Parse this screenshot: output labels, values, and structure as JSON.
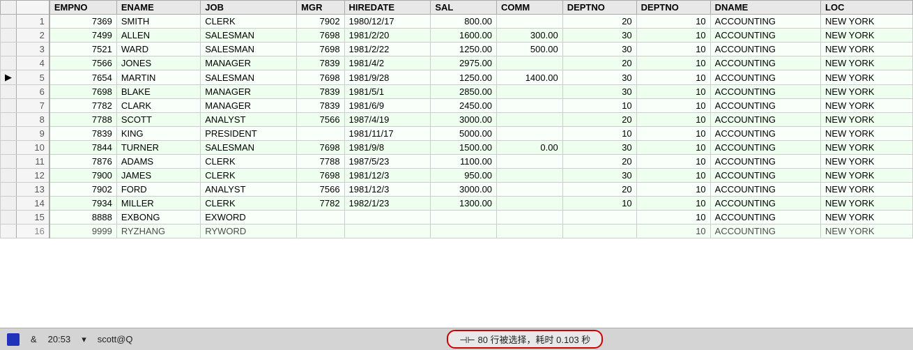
{
  "columns": [
    {
      "key": "indicator",
      "label": ""
    },
    {
      "key": "rownum",
      "label": ""
    },
    {
      "key": "empno",
      "label": "EMPNO"
    },
    {
      "key": "ename",
      "label": "ENAME"
    },
    {
      "key": "job",
      "label": "JOB"
    },
    {
      "key": "mgr",
      "label": "MGR"
    },
    {
      "key": "hiredate",
      "label": "HIREDATE"
    },
    {
      "key": "sal",
      "label": "SAL"
    },
    {
      "key": "comm",
      "label": "COMM"
    },
    {
      "key": "deptno1",
      "label": "DEPTNO"
    },
    {
      "key": "deptno2",
      "label": "DEPTNO"
    },
    {
      "key": "dname",
      "label": "DNAME"
    },
    {
      "key": "loc",
      "label": "LOC"
    }
  ],
  "rows": [
    {
      "rownum": 1,
      "empno": "7369",
      "ename": "SMITH",
      "job": "CLERK",
      "mgr": "7902",
      "hiredate": "1980/12/17",
      "sal": "800.00",
      "comm": "",
      "deptno1": "20",
      "deptno2": "10",
      "dname": "ACCOUNTING",
      "loc": "NEW  YORK",
      "indicator": false,
      "highlight": false
    },
    {
      "rownum": 2,
      "empno": "7499",
      "ename": "ALLEN",
      "job": "SALESMAN",
      "mgr": "7698",
      "hiredate": "1981/2/20",
      "sal": "1600.00",
      "comm": "300.00",
      "deptno1": "30",
      "deptno2": "10",
      "dname": "ACCOUNTING",
      "loc": "NEW  YORK",
      "indicator": false,
      "highlight": false
    },
    {
      "rownum": 3,
      "empno": "7521",
      "ename": "WARD",
      "job": "SALESMAN",
      "mgr": "7698",
      "hiredate": "1981/2/22",
      "sal": "1250.00",
      "comm": "500.00",
      "deptno1": "30",
      "deptno2": "10",
      "dname": "ACCOUNTING",
      "loc": "NEW  YORK",
      "indicator": false,
      "highlight": false
    },
    {
      "rownum": 4,
      "empno": "7566",
      "ename": "JONES",
      "job": "MANAGER",
      "mgr": "7839",
      "hiredate": "1981/4/2",
      "sal": "2975.00",
      "comm": "",
      "deptno1": "20",
      "deptno2": "10",
      "dname": "ACCOUNTING",
      "loc": "NEW  YORK",
      "indicator": false,
      "highlight": false
    },
    {
      "rownum": 5,
      "empno": "7654",
      "ename": "MARTIN",
      "job": "SALESMAN",
      "mgr": "7698",
      "hiredate": "1981/9/28",
      "sal": "1250.00",
      "comm": "1400.00",
      "deptno1": "30",
      "deptno2": "10",
      "dname": "ACCOUNTING",
      "loc": "NEW  YORK",
      "indicator": true,
      "highlight": false
    },
    {
      "rownum": 6,
      "empno": "7698",
      "ename": "BLAKE",
      "job": "MANAGER",
      "mgr": "7839",
      "hiredate": "1981/5/1",
      "sal": "2850.00",
      "comm": "",
      "deptno1": "30",
      "deptno2": "10",
      "dname": "ACCOUNTING",
      "loc": "NEW  YORK",
      "indicator": false,
      "highlight": false
    },
    {
      "rownum": 7,
      "empno": "7782",
      "ename": "CLARK",
      "job": "MANAGER",
      "mgr": "7839",
      "hiredate": "1981/6/9",
      "sal": "2450.00",
      "comm": "",
      "deptno1": "10",
      "deptno2": "10",
      "dname": "ACCOUNTING",
      "loc": "NEW  YORK",
      "indicator": false,
      "highlight": false
    },
    {
      "rownum": 8,
      "empno": "7788",
      "ename": "SCOTT",
      "job": "ANALYST",
      "mgr": "7566",
      "hiredate": "1987/4/19",
      "sal": "3000.00",
      "comm": "",
      "deptno1": "20",
      "deptno2": "10",
      "dname": "ACCOUNTING",
      "loc": "NEW  YORK",
      "indicator": false,
      "highlight": false
    },
    {
      "rownum": 9,
      "empno": "7839",
      "ename": "KING",
      "job": "PRESIDENT",
      "mgr": "",
      "hiredate": "1981/11/17",
      "sal": "5000.00",
      "comm": "",
      "deptno1": "10",
      "deptno2": "10",
      "dname": "ACCOUNTING",
      "loc": "NEW  YORK",
      "indicator": false,
      "highlight": false
    },
    {
      "rownum": 10,
      "empno": "7844",
      "ename": "TURNER",
      "job": "SALESMAN",
      "mgr": "7698",
      "hiredate": "1981/9/8",
      "sal": "1500.00",
      "comm": "0.00",
      "deptno1": "30",
      "deptno2": "10",
      "dname": "ACCOUNTING",
      "loc": "NEW  YORK",
      "indicator": false,
      "highlight": false
    },
    {
      "rownum": 11,
      "empno": "7876",
      "ename": "ADAMS",
      "job": "CLERK",
      "mgr": "7788",
      "hiredate": "1987/5/23",
      "sal": "1100.00",
      "comm": "",
      "deptno1": "20",
      "deptno2": "10",
      "dname": "ACCOUNTING",
      "loc": "NEW  YORK",
      "indicator": false,
      "highlight": false
    },
    {
      "rownum": 12,
      "empno": "7900",
      "ename": "JAMES",
      "job": "CLERK",
      "mgr": "7698",
      "hiredate": "1981/12/3",
      "sal": "950.00",
      "comm": "",
      "deptno1": "30",
      "deptno2": "10",
      "dname": "ACCOUNTING",
      "loc": "NEW  YORK",
      "indicator": false,
      "highlight": false
    },
    {
      "rownum": 13,
      "empno": "7902",
      "ename": "FORD",
      "job": "ANALYST",
      "mgr": "7566",
      "hiredate": "1981/12/3",
      "sal": "3000.00",
      "comm": "",
      "deptno1": "20",
      "deptno2": "10",
      "dname": "ACCOUNTING",
      "loc": "NEW  YORK",
      "indicator": false,
      "highlight": false
    },
    {
      "rownum": 14,
      "empno": "7934",
      "ename": "MILLER",
      "job": "CLERK",
      "mgr": "7782",
      "hiredate": "1982/1/23",
      "sal": "1300.00",
      "comm": "",
      "deptno1": "10",
      "deptno2": "10",
      "dname": "ACCOUNTING",
      "loc": "NEW  YORK",
      "indicator": false,
      "highlight": false
    },
    {
      "rownum": 15,
      "empno": "8888",
      "ename": "EXBONG",
      "job": "EXWORD",
      "mgr": "",
      "hiredate": "",
      "sal": "",
      "comm": "",
      "deptno1": "",
      "deptno2": "10",
      "dname": "ACCOUNTING",
      "loc": "NEW  YORK",
      "indicator": false,
      "highlight": false
    },
    {
      "rownum": 16,
      "empno": "9999",
      "ename": "RYZHANG",
      "job": "RYWORD",
      "mgr": "",
      "hiredate": "",
      "sal": "",
      "comm": "",
      "deptno1": "",
      "deptno2": "10",
      "dname": "ACCOUNTING",
      "loc": "NEW  YORK",
      "indicator": false,
      "highlight": false,
      "partial": true
    }
  ],
  "status_bar": {
    "icon_color": "#2233bb",
    "time": "20:53",
    "user": "scott@Q",
    "result_text": "⊣⊢ 80 行被选择，耗时 0.103 秒"
  }
}
